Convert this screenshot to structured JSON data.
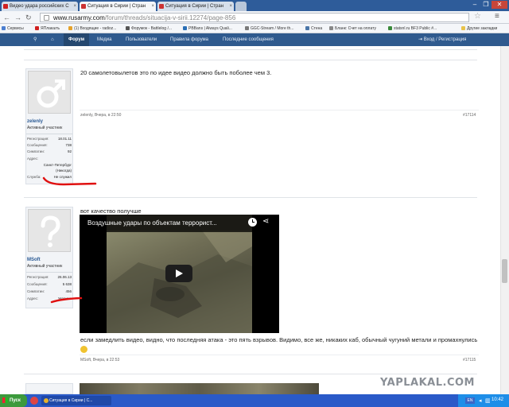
{
  "browser": {
    "tabs": [
      {
        "label": "Видео удара российских С"
      },
      {
        "label": "Ситуация в Сирии | Стран"
      },
      {
        "label": "Ситуация в Сирии | Стран"
      }
    ],
    "url_host": "www.rusarmy.com",
    "url_path": "/forum/threads/situacija-v-sirii.12274/page-856"
  },
  "bookmarks": [
    {
      "label": "Сервисы"
    },
    {
      "label": "ЯПлакалъ"
    },
    {
      "label": "(1) Входящие - radioz..."
    },
    {
      "label": "Форумок - Battlelog /..."
    },
    {
      "label": "PBBans | Always Quali..."
    },
    {
      "label": "GGC-Stream / More th..."
    },
    {
      "label": "Стена"
    },
    {
      "label": "Бланк: Счет на оплату"
    },
    {
      "label": "statsnl.ru BF3 Public #..."
    },
    {
      "label": "Другие закладки"
    }
  ],
  "forum_nav": {
    "items": [
      {
        "label": "Форум"
      },
      {
        "label": "Медиа"
      },
      {
        "label": "Пользователи"
      },
      {
        "label": "Правила форума"
      },
      {
        "label": "Последние сообщения"
      }
    ],
    "login": "Вход / Регистрация"
  },
  "posts": [
    {
      "author": "zelenly",
      "rank": "Активный участник",
      "fields": [
        {
          "label": "Регистрация:",
          "value": "18.01.11"
        },
        {
          "label": "Сообщения:",
          "value": "738"
        },
        {
          "label": "Симпатии:",
          "value": "92"
        },
        {
          "label": "Адрес:",
          "value": "Санкт-Петербург (Никогда)"
        },
        {
          "label": "Служба:",
          "value": "Не служил"
        }
      ],
      "text": "20 самолетовылетов это по идее видео должно быть поболее чем 3.",
      "meta": "zelenly, Вчера, в 22:50",
      "number": "#17114"
    },
    {
      "author": "MSoft",
      "rank": "Активный участник",
      "fields": [
        {
          "label": "Регистрация:",
          "value": "26.06.13"
        },
        {
          "label": "Сообщения:",
          "value": "5 638"
        },
        {
          "label": "Симпатии:",
          "value": "456"
        },
        {
          "label": "Адрес:",
          "value": "Украина"
        }
      ],
      "text_before": "вот качество получше",
      "video_title": "Воздушные удары по объектам террорист...",
      "text_after": "если замедлить видео, видно, что последняя атака - это пять взрывов. Видимо, все же, никаких каб, обычный чугуний метали и промахнулись",
      "meta": "MSoft, Вчера, в 22:53",
      "number": "#17115"
    }
  ],
  "watermark": "YAPLAKAL.COM",
  "taskbar": {
    "start": "Пуск",
    "tasks": [
      {
        "label": "Ситуация в Сирии | С..."
      }
    ],
    "lang": "EN",
    "clock": "10:42"
  },
  "colors": {
    "forum_nav": "#2f5a8e",
    "link": "#2b5a94",
    "annotation_red": "#e01010"
  }
}
